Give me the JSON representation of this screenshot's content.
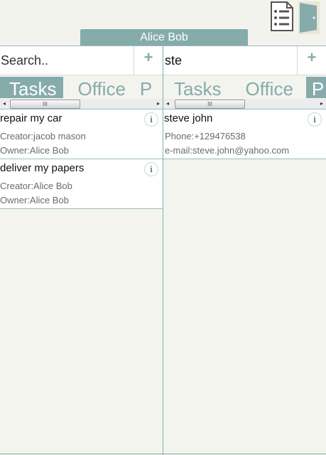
{
  "header": {
    "user_name": "Alice Bob"
  },
  "icons": {
    "menu": "list-icon",
    "logout": "door-icon",
    "accent": "#86abab"
  },
  "left_panel": {
    "search": {
      "value": "",
      "placeholder": "Search.."
    },
    "add_label": "+",
    "tabs": [
      {
        "label": "Tasks",
        "active": true
      },
      {
        "label": "Office",
        "active": false
      },
      {
        "label": "P",
        "active": false
      }
    ],
    "items": [
      {
        "title": "repair my car",
        "line1": "Creator:jacob mason",
        "line2": "Owner:Alice Bob",
        "info": "i"
      },
      {
        "title": "deliver my papers",
        "line1": "Creator:Alice Bob",
        "line2": "Owner:Alice Bob",
        "info": "i"
      }
    ]
  },
  "right_panel": {
    "search": {
      "value": "ste",
      "placeholder": "Search.."
    },
    "add_label": "+",
    "tabs": [
      {
        "label": "Tasks",
        "active": false
      },
      {
        "label": "Office",
        "active": false
      },
      {
        "label": "P",
        "active": true
      }
    ],
    "items": [
      {
        "title": "steve john",
        "line1": "Phone:+129476538",
        "line2": "e-mail:steve.john@yahoo.com",
        "info": "i"
      }
    ]
  },
  "scrollbar": {
    "thumb_grip": "III",
    "left_arrow": "◂",
    "right_arrow": "▸"
  }
}
